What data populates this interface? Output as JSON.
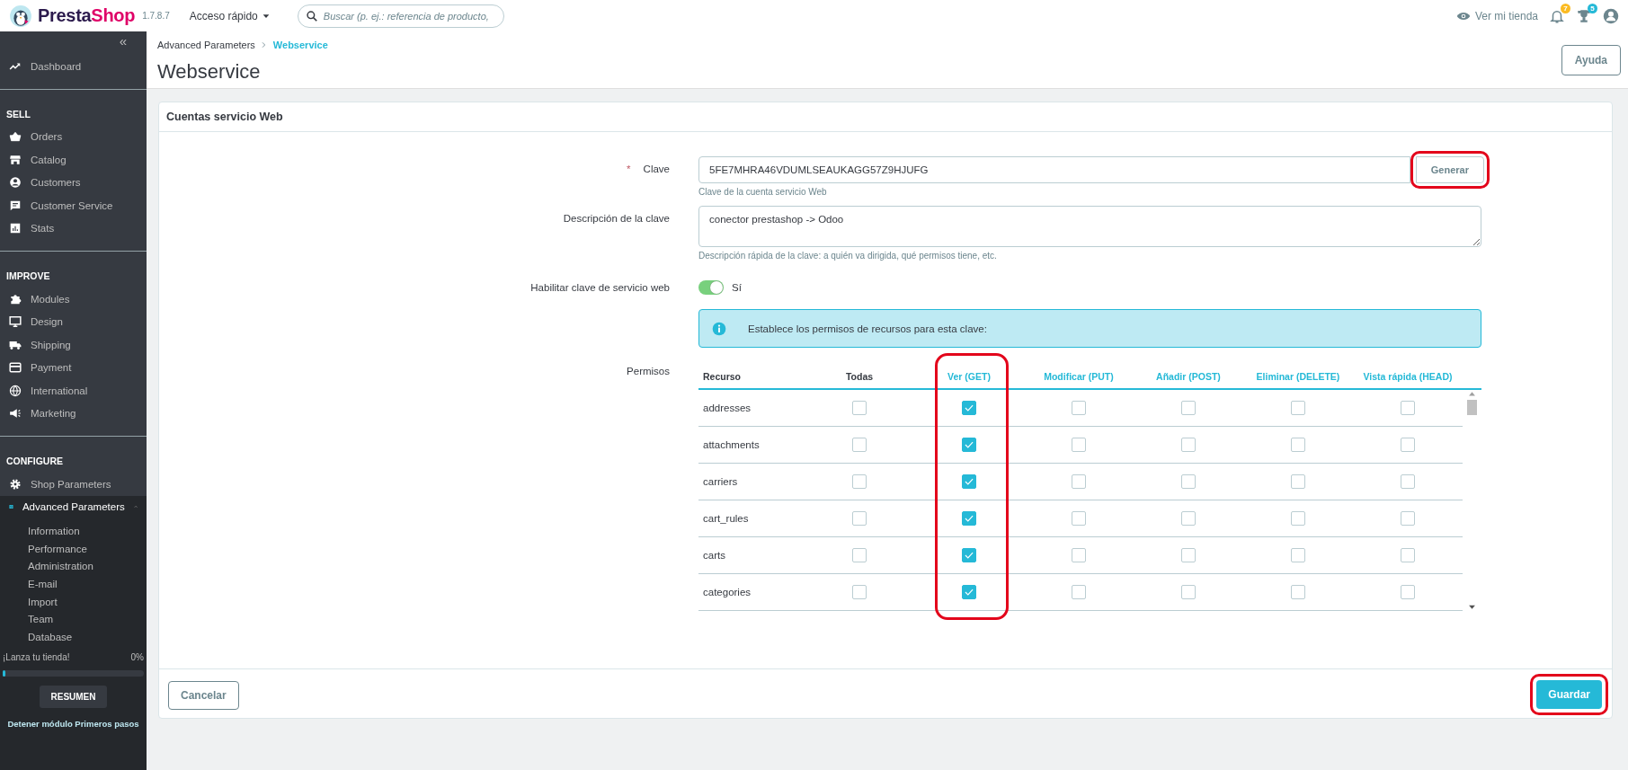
{
  "topbar": {
    "logo": "PrestaShop",
    "version": "1.7.8.7",
    "quick_access": "Acceso rápido",
    "search": {
      "placeholder": "Buscar (p. ej.: referencia de producto,"
    },
    "view_store": "Ver mi tienda",
    "notifications_count": "7",
    "achievements_count": "5"
  },
  "sidebar": {
    "collapse": "«",
    "top_items": [
      {
        "label": "Dashboard",
        "selected": false
      }
    ],
    "sections": [
      {
        "title": "SELL",
        "items": [
          {
            "label": "Orders",
            "selected": false
          },
          {
            "label": "Catalog",
            "selected": false
          },
          {
            "label": "Customers",
            "selected": false
          },
          {
            "label": "Customer Service",
            "selected": false
          },
          {
            "label": "Stats",
            "selected": false
          }
        ]
      },
      {
        "title": "IMPROVE",
        "items": [
          {
            "label": "Modules",
            "selected": false
          },
          {
            "label": "Design",
            "selected": false
          },
          {
            "label": "Shipping",
            "selected": false
          },
          {
            "label": "Payment",
            "selected": false
          },
          {
            "label": "International",
            "selected": false
          },
          {
            "label": "Marketing",
            "selected": false
          }
        ]
      },
      {
        "title": "CONFIGURE",
        "items": [
          {
            "label": "Shop Parameters",
            "selected": false
          },
          {
            "label": "Advanced Parameters",
            "selected": true,
            "expanded": true,
            "children": [
              {
                "label": "Information",
                "selected": false
              },
              {
                "label": "Performance",
                "selected": false
              },
              {
                "label": "Administration",
                "selected": false
              },
              {
                "label": "E-mail",
                "selected": false
              },
              {
                "label": "Import",
                "selected": false
              },
              {
                "label": "Team",
                "selected": false
              },
              {
                "label": "Database",
                "selected": false
              }
            ]
          }
        ]
      }
    ],
    "launch": {
      "label": "¡Lanza tu tienda!",
      "percent": "0%",
      "level": 0,
      "summary_button": "RESUMEN",
      "stop_link": "Detener módulo Primeros pasos"
    }
  },
  "breadcrumb": [
    {
      "label": "Advanced Parameters",
      "selected": false
    },
    {
      "label": "Webservice",
      "selected": true
    }
  ],
  "page_title": "Webservice",
  "help_button": "Ayuda",
  "card": {
    "title": "Cuentas servicio Web",
    "key_field": {
      "label": "Clave",
      "required_mark": "*",
      "value": "5FE7MHRA46VDUMLSEAUKAGG57Z9HJUFG",
      "help": "Clave de la cuenta servicio Web",
      "button": {
        "label": "Generar",
        "highlighted": true
      }
    },
    "description_field": {
      "label": "Descripción de la clave",
      "value": "conector prestashop -> Odoo",
      "help": "Descripción rápida de la clave: a quién va dirigida, qué permisos tiene, etc."
    },
    "enable_field": {
      "label": "Habilitar clave de servicio web",
      "on": true,
      "text": "Sí"
    },
    "info": "Establece los permisos de recursos para esta clave:",
    "permissions": {
      "label": "Permisos",
      "columns": [
        {
          "label": "Recurso",
          "kind": "resource",
          "highlighted": false
        },
        {
          "label": "Todas",
          "kind": "all",
          "highlighted": false
        },
        {
          "label": "Ver (GET)",
          "kind": "method",
          "highlighted": true
        },
        {
          "label": "Modificar (PUT)",
          "kind": "method",
          "highlighted": false
        },
        {
          "label": "Añadir (POST)",
          "kind": "method",
          "highlighted": false
        },
        {
          "label": "Eliminar (DELETE)",
          "kind": "method",
          "highlighted": false
        },
        {
          "label": "Vista rápida (HEAD)",
          "kind": "method",
          "highlighted": false
        }
      ],
      "rows": [
        {
          "resource": "addresses",
          "checked": [
            false,
            true,
            false,
            false,
            false,
            false
          ]
        },
        {
          "resource": "attachments",
          "checked": [
            false,
            true,
            false,
            false,
            false,
            false
          ]
        },
        {
          "resource": "carriers",
          "checked": [
            false,
            true,
            false,
            false,
            false,
            false
          ]
        },
        {
          "resource": "cart_rules",
          "checked": [
            false,
            true,
            false,
            false,
            false,
            false
          ]
        },
        {
          "resource": "carts",
          "checked": [
            false,
            true,
            false,
            false,
            false,
            false
          ]
        },
        {
          "resource": "categories",
          "checked": [
            false,
            true,
            false,
            false,
            false,
            false
          ]
        }
      ]
    },
    "cancel_button": "Cancelar",
    "save_button": {
      "label": "Guardar",
      "highlighted": true
    }
  }
}
